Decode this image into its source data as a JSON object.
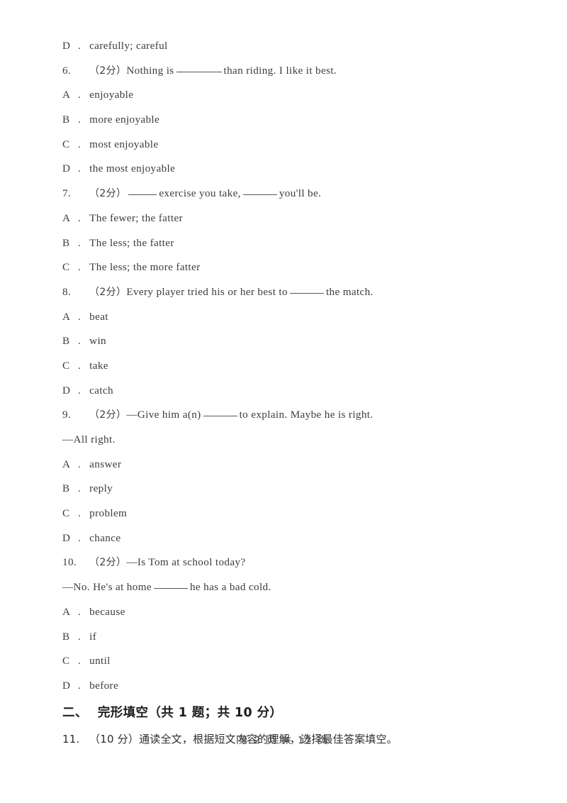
{
  "document": {
    "page_footer": "第 2 页 共 12 页",
    "page_number": "2",
    "total_pages": "12"
  },
  "orphan_option": {
    "letter": "D",
    "separator": ".",
    "text": "carefully; careful"
  },
  "questions": [
    {
      "number": "6.",
      "marks": "（2分）",
      "stem_before": "Nothing is",
      "blank": "b7",
      "stem_after": "than riding. I like it best.",
      "options": [
        {
          "letter": "A",
          "separator": ".",
          "text": "enjoyable"
        },
        {
          "letter": "B",
          "separator": ".",
          "text": "more enjoyable"
        },
        {
          "letter": "C",
          "separator": ".",
          "text": "most enjoyable"
        },
        {
          "letter": "D",
          "separator": ".",
          "text": "the most enjoyable"
        }
      ]
    },
    {
      "number": "7.",
      "marks": "（2分）",
      "stem_before": "",
      "blank": "b4",
      "stem_mid": "exercise you take,",
      "blank2": "b5",
      "stem_after": "you'll be.",
      "options": [
        {
          "letter": "A",
          "separator": ".",
          "text": "The fewer; the fatter"
        },
        {
          "letter": "B",
          "separator": ".",
          "text": "The less; the fatter"
        },
        {
          "letter": "C",
          "separator": ".",
          "text": "The less; the more fatter"
        }
      ]
    },
    {
      "number": "8.",
      "marks": "（2分）",
      "stem_before": "Every player tried his or her best to",
      "blank": "b5",
      "stem_after": "the match.",
      "options": [
        {
          "letter": "A",
          "separator": ".",
          "text": "beat"
        },
        {
          "letter": "B",
          "separator": ".",
          "text": "win"
        },
        {
          "letter": "C",
          "separator": ".",
          "text": "take"
        },
        {
          "letter": "D",
          "separator": ".",
          "text": "catch"
        }
      ]
    },
    {
      "number": "9.",
      "marks": "（2分）",
      "stem_before": "—Give him a(n)",
      "blank": "b5",
      "stem_after": "to explain. Maybe he is right.",
      "stem_line2": "—All right.",
      "options": [
        {
          "letter": "A",
          "separator": ".",
          "text": "answer"
        },
        {
          "letter": "B",
          "separator": ".",
          "text": "reply"
        },
        {
          "letter": "C",
          "separator": ".",
          "text": "problem"
        },
        {
          "letter": "D",
          "separator": ".",
          "text": "chance"
        }
      ]
    },
    {
      "number": "10.",
      "marks": "（2分）",
      "stem_before": "—Is Tom at school today?",
      "stem_line2_before": "—No. He's at home",
      "blank": "b5",
      "stem_line2_after": "he has a bad cold.",
      "options": [
        {
          "letter": "A",
          "separator": ".",
          "text": "because"
        },
        {
          "letter": "B",
          "separator": ".",
          "text": "if"
        },
        {
          "letter": "C",
          "separator": ".",
          "text": "until"
        },
        {
          "letter": "D",
          "separator": ".",
          "text": "before"
        }
      ]
    }
  ],
  "section": {
    "number": "二、",
    "title": "完形填空（共 1 题；共 10 分）"
  },
  "final_question": {
    "number": "11.",
    "marks": "（10 分）",
    "text": "通读全文，根据短文内容的理解，选择最佳答案填空。"
  }
}
